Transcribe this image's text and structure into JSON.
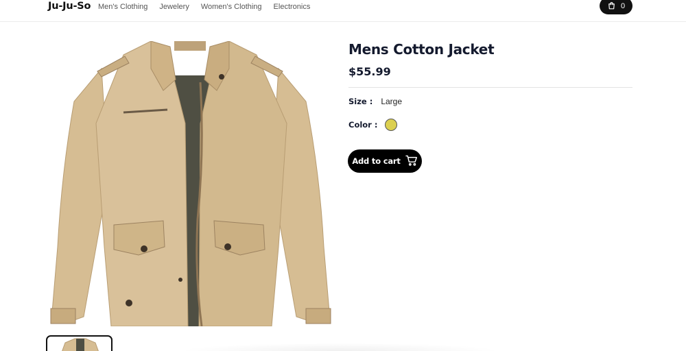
{
  "brand": {
    "logo": "Ju-Ju-So"
  },
  "nav": {
    "items": [
      {
        "label": "Men's Clothing"
      },
      {
        "label": "Jewelery"
      },
      {
        "label": "Women's Clothing"
      },
      {
        "label": "Electronics"
      }
    ]
  },
  "cart": {
    "count": "0",
    "icon": "shopping-bag-icon"
  },
  "product": {
    "title": "Mens Cotton Jacket",
    "price": "$55.99",
    "size_label": "Size :",
    "size_value": "Large",
    "color_label": "Color :",
    "color_value": "#dcd050",
    "add_to_cart_label": "Add to cart",
    "add_to_cart_icon": "cart-icon"
  },
  "colors": {
    "primary": "#000000",
    "text": "#141a2e",
    "jacket": "#d3b98f"
  }
}
